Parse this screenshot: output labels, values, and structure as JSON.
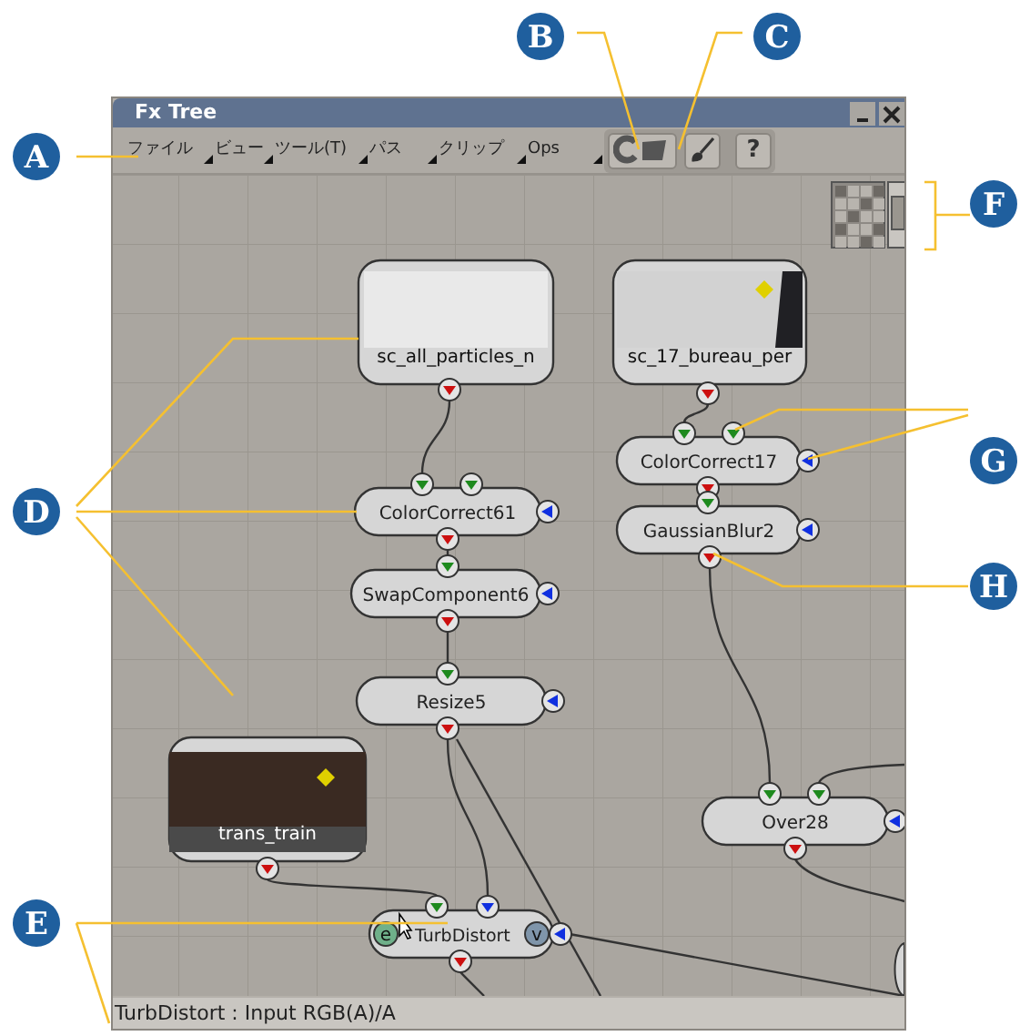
{
  "window": {
    "title": "Fx Tree"
  },
  "menus": [
    {
      "label": "ファイル"
    },
    {
      "label": "ビュー"
    },
    {
      "label": "ツール(T)"
    },
    {
      "label": "パス"
    },
    {
      "label": "クリップ"
    },
    {
      "label": "Ops"
    }
  ],
  "toolbar": {
    "help_label": "?"
  },
  "nodes": [
    {
      "kind": "clip",
      "label": "sc_all_particles_n"
    },
    {
      "kind": "clip",
      "label": "sc_17_bureau_per"
    },
    {
      "kind": "fx",
      "label": "ColorCorrect17"
    },
    {
      "kind": "fx",
      "label": "ColorCorrect61"
    },
    {
      "kind": "fx",
      "label": "GaussianBlur2"
    },
    {
      "kind": "fx",
      "label": "SwapComponent6"
    },
    {
      "kind": "fx",
      "label": "Resize5"
    },
    {
      "kind": "clip",
      "label": "trans_train"
    },
    {
      "kind": "fx",
      "label": "Over28"
    },
    {
      "kind": "fx",
      "label": "TurbDistort",
      "badges": [
        "e",
        "v"
      ]
    }
  ],
  "status_bar": "TurbDistort : Input RGB(A)/A",
  "callouts": [
    "A",
    "B",
    "C",
    "D",
    "E",
    "F",
    "G",
    "H"
  ]
}
